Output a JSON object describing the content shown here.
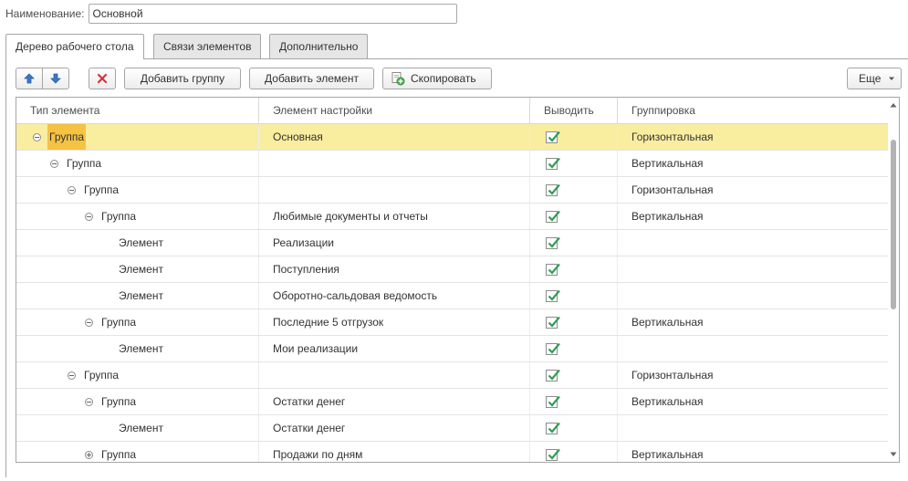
{
  "form": {
    "name_label": "Наименование:",
    "name_value": "Основной"
  },
  "tabs": [
    {
      "label": "Дерево рабочего стола"
    },
    {
      "label": "Связи элементов"
    },
    {
      "label": "Дополнительно"
    }
  ],
  "toolbar": {
    "add_group": "Добавить группу",
    "add_element": "Добавить элемент",
    "copy": "Скопировать",
    "more": "Еще"
  },
  "table": {
    "columns": [
      "Тип элемента",
      "Элемент настройки",
      "Выводить",
      "Группировка"
    ],
    "rows": [
      {
        "type": "Группа",
        "setting": "Основная",
        "grouping": "Горизонтальная"
      },
      {
        "type": "Группа",
        "setting": "",
        "grouping": "Вертикальная"
      },
      {
        "type": "Группа",
        "setting": "",
        "grouping": "Горизонтальная"
      },
      {
        "type": "Группа",
        "setting": "Любимые документы и отчеты",
        "grouping": "Вертикальная"
      },
      {
        "type": "Элемент",
        "setting": "Реализации",
        "grouping": ""
      },
      {
        "type": "Элемент",
        "setting": "Поступления",
        "grouping": ""
      },
      {
        "type": "Элемент",
        "setting": "Оборотно-сальдовая ведомость",
        "grouping": ""
      },
      {
        "type": "Группа",
        "setting": "Последние 5 отгрузок",
        "grouping": "Вертикальная"
      },
      {
        "type": "Элемент",
        "setting": "Мои реализации",
        "grouping": ""
      },
      {
        "type": "Группа",
        "setting": "",
        "grouping": "Горизонтальная"
      },
      {
        "type": "Группа",
        "setting": "Остатки денег",
        "grouping": "Вертикальная"
      },
      {
        "type": "Элемент",
        "setting": "Остатки денег",
        "grouping": ""
      },
      {
        "type": "Группа",
        "setting": "Продажи по дням",
        "grouping": "Вертикальная"
      }
    ]
  },
  "colors": {
    "selection_row": "#f9eda0",
    "selection_cell": "#f5c242",
    "checkmark": "#2e9e55",
    "arrow_blue": "#3b78c4",
    "delete_red": "#d9323a"
  }
}
